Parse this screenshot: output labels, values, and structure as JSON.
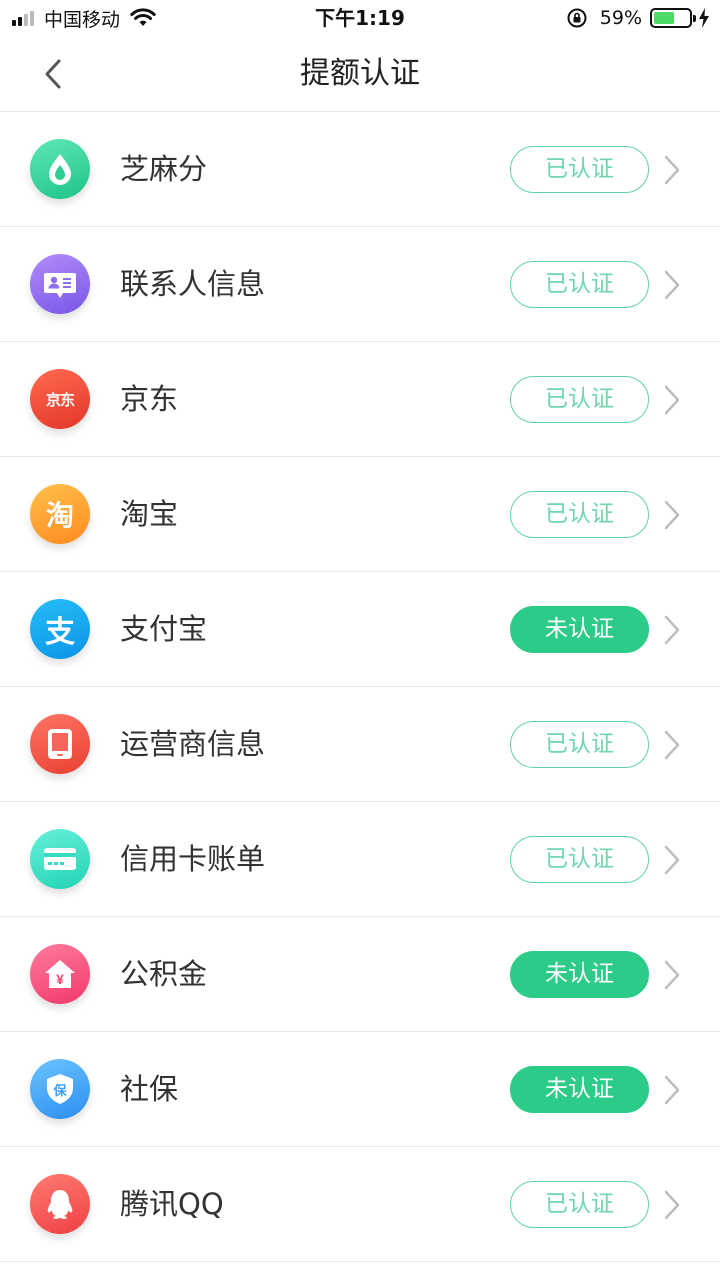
{
  "status_bar": {
    "carrier": "中国移动",
    "time": "下午1:19",
    "battery_percent": "59%",
    "battery_level": 0.59
  },
  "nav": {
    "title": "提额认证",
    "back_icon": "chevron-left-icon"
  },
  "colors": {
    "verified_border": "#5fd3a6",
    "pending_fill": "#2dcb88"
  },
  "items": [
    {
      "label": "芝麻分",
      "status": "已认证",
      "verified": true,
      "icon": "sesame-drop-icon",
      "color": "#33d49b"
    },
    {
      "label": "联系人信息",
      "status": "已认证",
      "verified": true,
      "icon": "contact-card-icon",
      "color": "#8f6cf0"
    },
    {
      "label": "京东",
      "status": "已认证",
      "verified": true,
      "icon": "jd-logo-icon",
      "icon_text": "京东",
      "color": "#ef4a3b"
    },
    {
      "label": "淘宝",
      "status": "已认证",
      "verified": true,
      "icon": "taobao-logo-icon",
      "icon_text": "淘",
      "color": "#ffa232"
    },
    {
      "label": "支付宝",
      "status": "未认证",
      "verified": false,
      "icon": "alipay-logo-icon",
      "icon_text": "支",
      "color": "#10a6ee"
    },
    {
      "label": "运营商信息",
      "status": "已认证",
      "verified": true,
      "icon": "phone-device-icon",
      "color": "#f5544a"
    },
    {
      "label": "信用卡账单",
      "status": "已认证",
      "verified": true,
      "icon": "credit-card-icon",
      "color": "#3de2c6"
    },
    {
      "label": "公积金",
      "status": "未认证",
      "verified": false,
      "icon": "house-yuan-icon",
      "icon_text": "¥",
      "color": "#ff4f7b"
    },
    {
      "label": "社保",
      "status": "未认证",
      "verified": false,
      "icon": "shield-icon",
      "icon_text": "保",
      "color": "#3aa8f6"
    },
    {
      "label": "腾讯QQ",
      "status": "已认证",
      "verified": true,
      "icon": "qq-penguin-icon",
      "color": "#ff5b5b"
    }
  ]
}
